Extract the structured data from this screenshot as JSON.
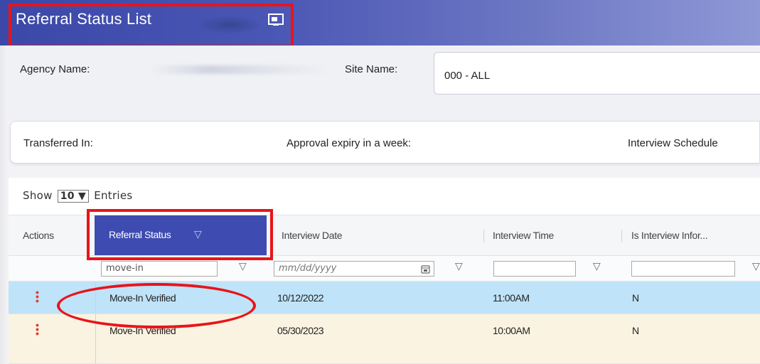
{
  "window": {
    "title": "Referral Status List"
  },
  "filters": {
    "agency_label": "Agency Name:",
    "site_label": "Site Name:",
    "site_value": "000 - ALL"
  },
  "summary": {
    "items": [
      {
        "label": "Transferred In:"
      },
      {
        "label": "Approval expiry in a week:"
      },
      {
        "label": "Interview Schedule"
      }
    ]
  },
  "table": {
    "show_prefix": "Show",
    "page_size": "10",
    "show_suffix": "Entries",
    "columns": [
      {
        "label": "Actions"
      },
      {
        "label": "Referral Status"
      },
      {
        "label": "Interview Date"
      },
      {
        "label": "Interview Time"
      },
      {
        "label": "Is Interview Infor..."
      }
    ],
    "column_filters": {
      "referral_status": "move-in",
      "interview_date_placeholder": "mm/dd/yyyy",
      "interview_time": "",
      "is_interview_info": ""
    },
    "rows": [
      {
        "referral_status": "Move-In Verified",
        "interview_date": "10/12/2022",
        "interview_time": "11:00AM",
        "is_interview_info": "N",
        "selected": true
      },
      {
        "referral_status": "Move-In Verified",
        "interview_date": "05/30/2023",
        "interview_time": "10:00AM",
        "is_interview_info": "N",
        "selected": false
      }
    ]
  },
  "colors": {
    "titlebar": "#3b48a8",
    "active_header": "#3e4bb0",
    "selected_row": "#bfe3f8",
    "alt_row": "#faf3e1",
    "annotation_red": "#e8141a",
    "actions_dots": "#e33a2a"
  },
  "icons": {
    "title_icon": "screen-share-icon",
    "filter_icon": "filter-icon",
    "calendar_icon": "calendar-icon",
    "actions_icon": "kebab-menu-icon"
  }
}
